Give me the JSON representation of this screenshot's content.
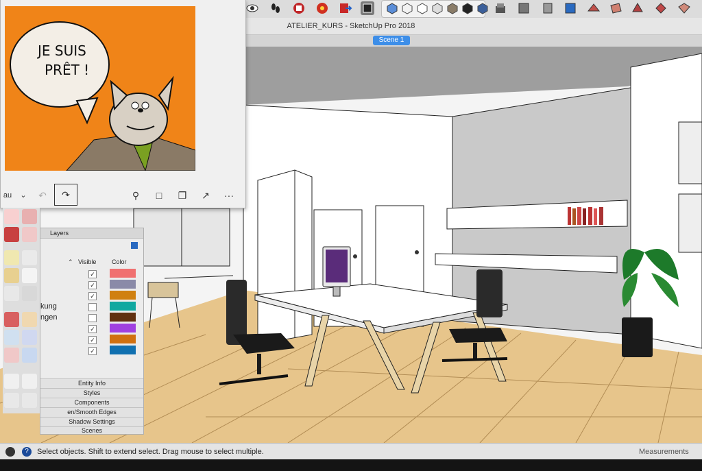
{
  "window": {
    "title": "ATELIER_KURS - SketchUp Pro 2018"
  },
  "scenes": [
    {
      "label": "Scene 1",
      "active": true
    }
  ],
  "photo_viewer": {
    "speech_text_line1": "JE SUIS",
    "speech_text_line2": "PRÊT !",
    "toolbar": {
      "dropdown_partial": "au",
      "undo_icon": "undo-icon",
      "redo_icon": "redo-icon",
      "zoom_icon": "zoom-in-icon",
      "save_icon": "save-icon",
      "copy_icon": "copy-icon",
      "share_icon": "share-icon",
      "more_label": "···"
    }
  },
  "tray": {
    "layers_title": "Layers",
    "columns": {
      "visible": "Visible",
      "color": "Color"
    },
    "layers": [
      {
        "name": "",
        "visible": true,
        "color": "#f07070"
      },
      {
        "name": "",
        "visible": true,
        "color": "#8a8aa8"
      },
      {
        "name": "",
        "visible": true,
        "color": "#d08010"
      },
      {
        "name": "kung",
        "visible": false,
        "color": "#10a8a0"
      },
      {
        "name": "ngen",
        "visible": false,
        "color": "#603010"
      },
      {
        "name": "",
        "visible": true,
        "color": "#a040e0"
      },
      {
        "name": "",
        "visible": true,
        "color": "#d07010"
      },
      {
        "name": "",
        "visible": true,
        "color": "#1070b0"
      }
    ],
    "panels": [
      "Entity Info",
      "Styles",
      "Components",
      "en/Smooth Edges",
      "Shadow Settings",
      "Scenes"
    ]
  },
  "statusbar": {
    "text": "Select objects. Shift to extend select. Drag mouse to select multiple.",
    "measurements_label": "Measurements"
  },
  "colors": {
    "accent": "#3d8ee8",
    "photo_bg": "#f08418",
    "floor": "#e7c58b"
  }
}
